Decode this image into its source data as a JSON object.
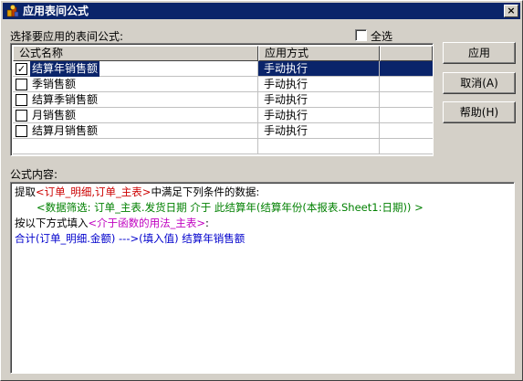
{
  "window": {
    "title": "应用表间公式",
    "close_label": "×"
  },
  "prompt_label": "选择要应用的表间公式:",
  "select_all_label": "全选",
  "columns": [
    "公式名称",
    "应用方式"
  ],
  "rows": [
    {
      "name": "结算年销售额",
      "mode": "手动执行",
      "checked": "✓"
    },
    {
      "name": "季销售额",
      "mode": "手动执行",
      "checked": ""
    },
    {
      "name": "结算季销售额",
      "mode": "手动执行",
      "checked": ""
    },
    {
      "name": "月销售额",
      "mode": "手动执行",
      "checked": ""
    },
    {
      "name": "结算月销售额",
      "mode": "手动执行",
      "checked": ""
    }
  ],
  "buttons": {
    "apply": "应用",
    "cancel": "取消(A)",
    "help": "帮助(H)"
  },
  "formula_label": "公式内容:",
  "formula": {
    "l1_a": "提取",
    "l1_b": "<订单_明细,订单_主表>",
    "l1_c": "中满足下列条件的数据:",
    "l2": "<数据筛选: 订单_主表.发货日期 介于 此结算年(结算年份(本报表.Sheet1:日期)) >",
    "l3_a": "按以下方式填入",
    "l3_b": "<介于函数的用法_主表>",
    "l3_c": ":",
    "l4": "合计(订单_明细.金额)  --->(填入值)  结算年销售额"
  }
}
